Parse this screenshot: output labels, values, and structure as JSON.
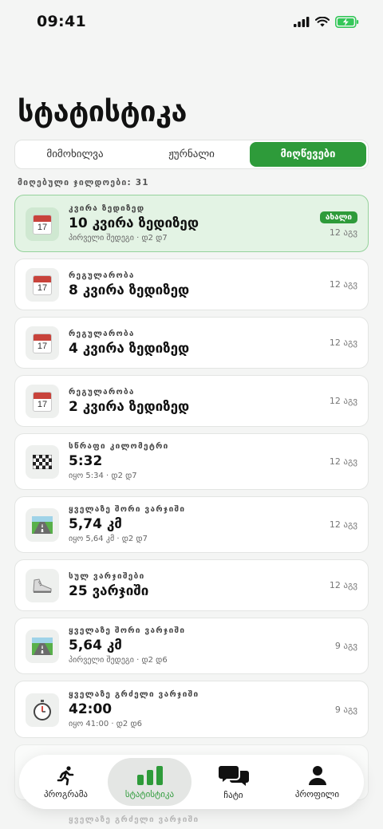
{
  "status_bar": {
    "time": "09:41"
  },
  "page": {
    "title": "სტატისტიკა"
  },
  "segments": [
    {
      "label": "მიმოხილვა"
    },
    {
      "label": "ჟურნალი"
    },
    {
      "label": "მიღწევები"
    }
  ],
  "earned": "მიღებული ჯილდოები: 31",
  "cards": [
    {
      "icon": "calendar-icon",
      "cal_num": "17",
      "label": "კვირა ზედიზედ",
      "value": "10 კვირა ზედიზედ",
      "sub": "პირველი შედეგი · დ2 დ7",
      "date": "12 აგვ",
      "badge": "ახალი"
    },
    {
      "icon": "calendar-icon",
      "cal_num": "17",
      "label": "რეგულარობა",
      "value": "8 კვირა ზედიზედ",
      "sub": "",
      "date": "12 აგვ"
    },
    {
      "icon": "calendar-icon",
      "cal_num": "17",
      "label": "რეგულარობა",
      "value": "4 კვირა ზედიზედ",
      "sub": "",
      "date": "12 აგვ"
    },
    {
      "icon": "calendar-icon",
      "cal_num": "17",
      "label": "რეგულარობა",
      "value": "2 კვირა ზედიზედ",
      "sub": "",
      "date": "12 აგვ"
    },
    {
      "icon": "checkered-flag-icon",
      "label": "სწრაფი კილომეტრი",
      "value": "5:32",
      "sub": "იყო 5:34 · დ2 დ7",
      "date": "12 აგვ"
    },
    {
      "icon": "road-icon",
      "label": "ყველაზე შორი ვარჯიში",
      "value": "5,74 კმ",
      "sub": "იყო 5,64 კმ · დ2 დ7",
      "date": "12 აგვ"
    },
    {
      "icon": "sneaker-icon",
      "label": "სულ ვარჯიშები",
      "value": "25 ვარჯიში",
      "sub": "",
      "date": "12 აგვ"
    },
    {
      "icon": "road-icon",
      "label": "ყველაზე შორი ვარჯიში",
      "value": "5,64 კმ",
      "sub": "პირველი შედეგი · დ2 დ6",
      "date": "9 აგვ"
    },
    {
      "icon": "stopwatch-icon",
      "label": "ყველაზე გრძელი ვარჯიში",
      "value": "42:00",
      "sub": "იყო 41:00 · დ2 დ6",
      "date": "9 აგვ"
    }
  ],
  "ghost_label": "ყველაზე გრძელი ვარჯიში",
  "tabs": [
    {
      "label": "პროგრამა",
      "icon": "runner-icon"
    },
    {
      "label": "სტატისტიკა",
      "icon": "bar-chart-icon"
    },
    {
      "label": "ჩატი",
      "icon": "chat-bubbles-icon"
    },
    {
      "label": "პროფილი",
      "icon": "person-icon"
    }
  ],
  "colors": {
    "accent": "#2e9b3a",
    "highlight_bg": "#e3f3e4",
    "background": "#f4f5f4"
  }
}
